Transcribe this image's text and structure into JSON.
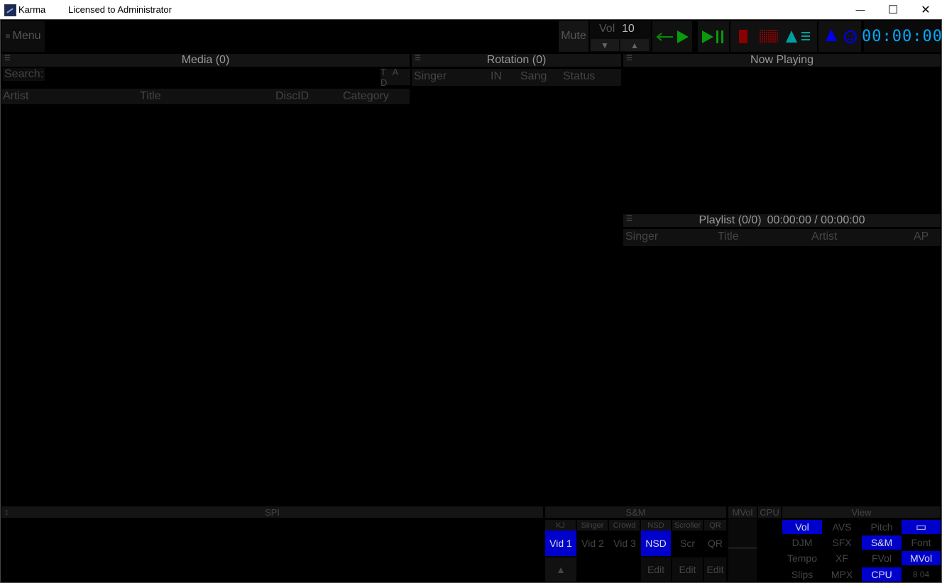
{
  "window": {
    "app_name": "Karma",
    "license": "Licensed to Administrator",
    "minimize": "—",
    "maximize": "☐",
    "close": "✕"
  },
  "toolbar": {
    "menu_label": "Menu",
    "menu_icon": "≡",
    "mute_label": "Mute",
    "vol_label": "Vol",
    "vol_value": "10",
    "vol_down": "▼",
    "vol_up": "▲",
    "time": "00:00:00",
    "colors": {
      "green": "#0a8a0a",
      "red": "#8a0000",
      "teal": "#00a0a0",
      "blue": "#0000ee",
      "time": "#00aaff"
    }
  },
  "media": {
    "title": "Media (0)",
    "search_label": "Search:",
    "filter_label": "T A D",
    "columns": [
      "Artist",
      "Title",
      "DiscID",
      "Category"
    ]
  },
  "rotation": {
    "title": "Rotation (0)",
    "columns": [
      "Singer",
      "IN",
      "Sang",
      "Status"
    ]
  },
  "now_playing": {
    "title": "Now Playing"
  },
  "playlist": {
    "title": "Playlist (0/0)",
    "time": "00:00:00 / 00:00:00",
    "columns": [
      "Singer",
      "Title",
      "Artist",
      "AP"
    ]
  },
  "spi": {
    "title": "SPI",
    "resize_icon": "↕"
  },
  "sm": {
    "title": "S&M",
    "tabs": [
      "KJ",
      "Singer",
      "Crowd",
      "NSD",
      "Scroller",
      "QR"
    ],
    "buttons": [
      "Vid 1",
      "Vid 2",
      "Vid 3",
      "NSD",
      "Scr",
      "QR"
    ],
    "up_arrow": "▲",
    "edit_labels": [
      "Edit",
      "Edit",
      "Edit"
    ]
  },
  "mvol": {
    "title": "MVol"
  },
  "cpu": {
    "title": "CPU"
  },
  "view": {
    "title": "View",
    "rows": [
      [
        "Vol",
        "AVS",
        "Pitch",
        ""
      ],
      [
        "DJM",
        "SFX",
        "S&M",
        "Font"
      ],
      [
        "Tempo",
        "XF",
        "FVol",
        "MVol"
      ],
      [
        "Slips",
        "MPX",
        "CPU",
        "8 04"
      ]
    ],
    "screen_icon": "▭"
  }
}
